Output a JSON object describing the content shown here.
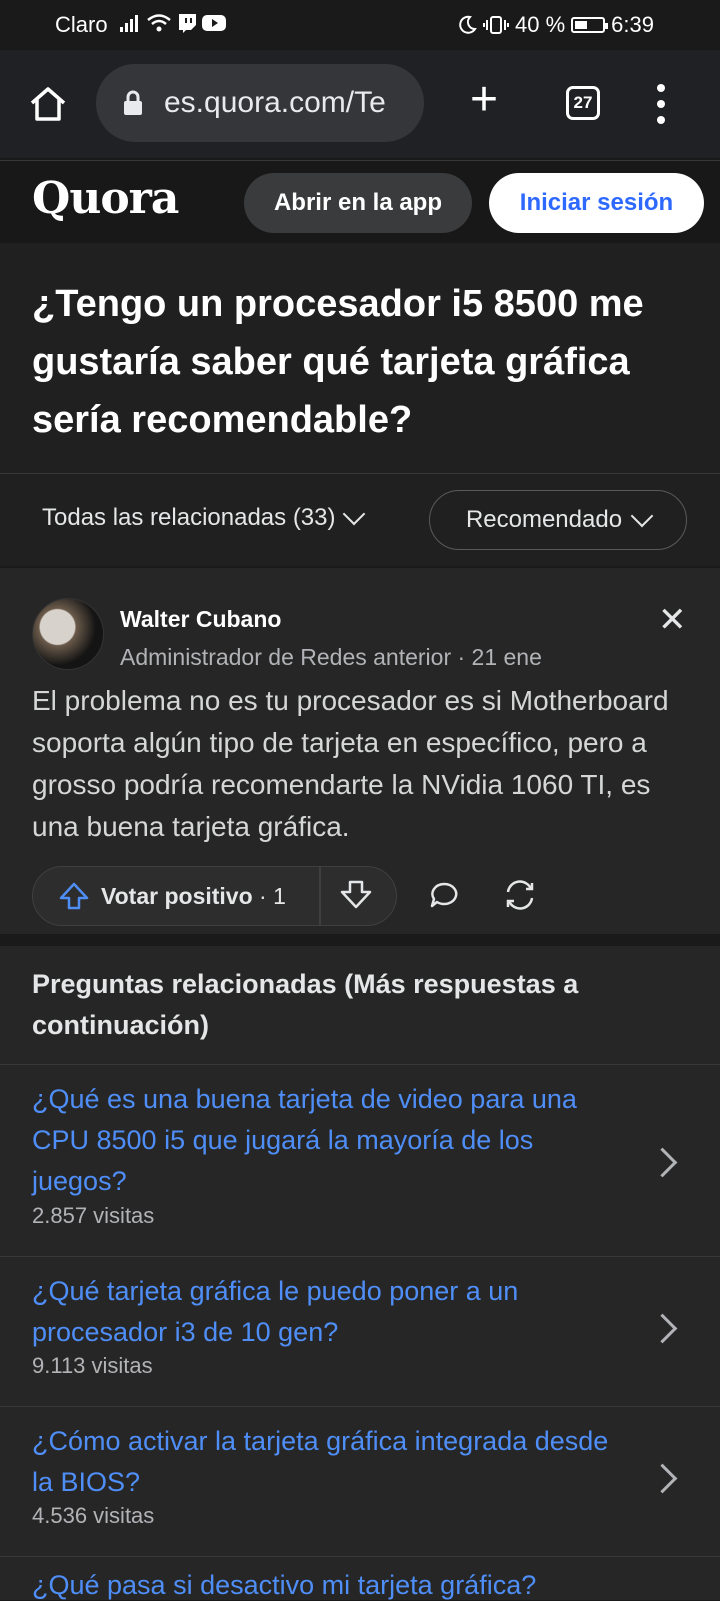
{
  "status_bar": {
    "carrier": "Claro",
    "battery": "40 %",
    "time": "6:39",
    "battery_level": 0.4
  },
  "browser": {
    "url": "es.quora.com/Te",
    "tab_count": "27"
  },
  "header": {
    "logo": "Quora",
    "open_app": "Abrir en la app",
    "login": "Iniciar sesión"
  },
  "question": {
    "title": "¿Tengo un procesador i5 8500 me gustaría saber qué tarjeta gráfica sería recomendable?"
  },
  "filters": {
    "all_related": "Todas las relacionadas (33)",
    "sort": "Recomendado"
  },
  "answer": {
    "author": "Walter Cubano",
    "credential": "Administrador de Redes anterior · 21 ene",
    "text": "El problema no es tu procesador es si Motherboard soporta algún tipo de tarjeta en específico, pero a grosso podría recomendarte la NVidia 1060 TI, es una buena tarjeta gráfica.",
    "upvote_label": "Votar positivo",
    "upvote_count": "· 1"
  },
  "related": {
    "header": "Preguntas relacionadas (Más respuestas a continuación)",
    "items": [
      {
        "question": "¿Qué es una buena tarjeta de video para una CPU 8500 i5 que jugará la mayoría de los juegos?",
        "views": "2.857 visitas"
      },
      {
        "question": "¿Qué tarjeta gráfica le puedo poner a un procesador i3 de 10 gen?",
        "views": "9.113 visitas"
      },
      {
        "question": "¿Cómo activar la tarjeta gráfica integrada desde la BIOS?",
        "views": "4.536 visitas"
      },
      {
        "question": "¿Qué pasa si desactivo mi tarjeta gráfica?",
        "views": ""
      }
    ]
  },
  "colors": {
    "link": "#4f8ef7",
    "login_text": "#2e69ff",
    "background": "#1a1a1a"
  }
}
